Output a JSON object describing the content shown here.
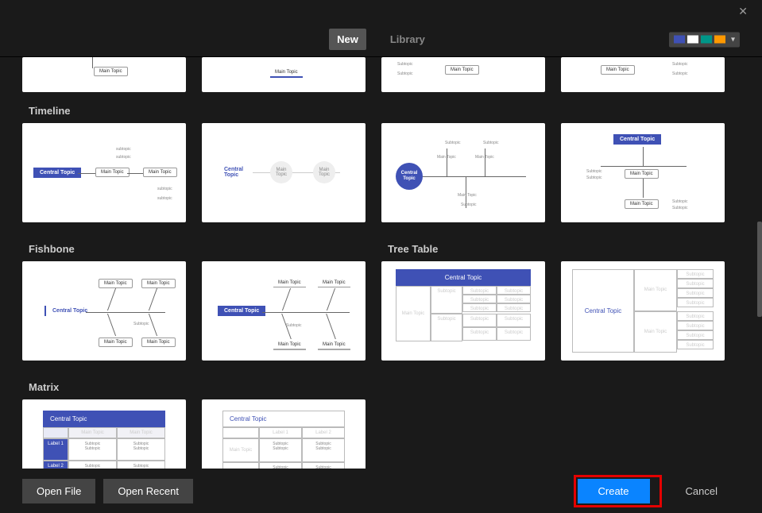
{
  "tabs": {
    "new": "New",
    "library": "Library"
  },
  "theme_colors": [
    "#3f51b5",
    "#ffffff",
    "#009688",
    "#ff9800"
  ],
  "sections": {
    "timeline": "Timeline",
    "fishbone": "Fishbone",
    "treetable": "Tree Table",
    "matrix": "Matrix"
  },
  "labels": {
    "central_topic": "Central Topic",
    "main_topic": "Main Topic",
    "subtopic": "Subtopic",
    "label1": "Label 1",
    "label2": "Label 2"
  },
  "footer": {
    "open_file": "Open File",
    "open_recent": "Open Recent",
    "create": "Create",
    "cancel": "Cancel"
  }
}
